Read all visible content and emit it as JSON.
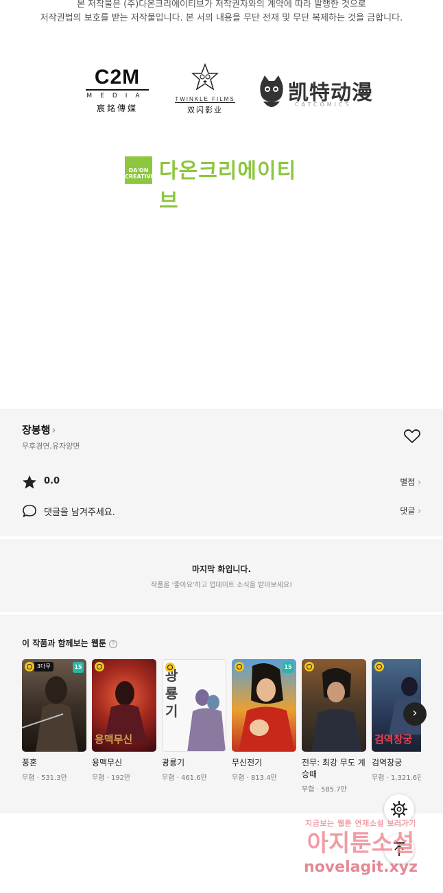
{
  "copyright": {
    "line1": "본 저작물은 (주)다온크리에이티브가 저작권자와의 계약에 따라 발행한 것으로",
    "line2": "저작권법의 보호를 받는 저작물입니다. 본 서의 내용을 무단 전재 및 무단 복제하는 것을 금합니다."
  },
  "logos": {
    "c2m_big": "C2M",
    "c2m_sub": "MEDIA",
    "c2m_cn": "宸銘傳媒",
    "twinkle_en": "TWINKLE FILMS",
    "twinkle_cn": "双闪影业",
    "cat_cn": "凯特动漫",
    "cat_en": "CATCOMICS",
    "daon_box": "DA'ON CREATIVE",
    "daon_text": "다온크리에이티브"
  },
  "info": {
    "author": "장봉행",
    "genre": "무후경연,유자양면",
    "score": "0.0",
    "rate_link": "별점",
    "comment_prompt": "댓글을 남겨주세요.",
    "comment_link": "댓글"
  },
  "last_episode": {
    "title": "마지막 화입니다.",
    "subtitle": "작품을 '좋아요'하고 업데이트 소식을 받아보세요!"
  },
  "recommend": {
    "title": "이 작품과 함께보는 웹툰",
    "help": "?",
    "items": [
      {
        "name": "풍혼",
        "genre": "무협",
        "views": "531.3만",
        "badge": "3다무",
        "age": "15",
        "cover": ""
      },
      {
        "name": "용맥무신",
        "genre": "무협",
        "views": "192만",
        "badge": "",
        "age": "",
        "cover": "용맥무신"
      },
      {
        "name": "광룡기",
        "genre": "무협",
        "views": "461.6만",
        "badge": "",
        "age": "",
        "cover": "광룡기"
      },
      {
        "name": "무신전기",
        "genre": "무협",
        "views": "813.4만",
        "badge": "",
        "age": "15",
        "cover": ""
      },
      {
        "name": "전무: 최강 무도 계승때",
        "genre": "무협",
        "views": "585.7만",
        "badge": "",
        "age": "",
        "cover": ""
      },
      {
        "name": "검역창궁",
        "genre": "무협",
        "views": "1,321.6만",
        "badge": "",
        "age": "",
        "cover": "검역창궁"
      }
    ]
  },
  "watermark": {
    "line1": "지금보는 웹툰 연재소설 보러가기",
    "line2": "아지툰소설",
    "line3": "novelagit.xyz"
  },
  "colors": {
    "accent_green": "#8dc63f",
    "age_badge": "#29b6a8",
    "clock_badge": "#f5c518"
  }
}
